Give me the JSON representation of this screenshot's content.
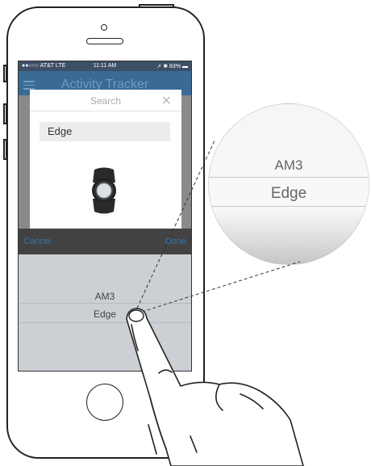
{
  "status_bar": {
    "carrier": "●●○○○ AT&T  LTE",
    "time": "11:11 AM",
    "battery": "➚ ✱ 83% ▬"
  },
  "nav": {
    "title": "Activity Tracker"
  },
  "dialog": {
    "title": "Search",
    "close": "✕",
    "search_value": "Edge"
  },
  "toolbar": {
    "cancel": "Cancel",
    "done": "Done"
  },
  "picker": {
    "options": [
      "AM3",
      "Edge"
    ],
    "selected": "Edge"
  },
  "magnifier": {
    "options": [
      "AM3",
      "Edge"
    ]
  },
  "colors": {
    "nav_bg": "#3b6a95",
    "accent": "#3b74ad",
    "toolbar_bg": "#424242",
    "picker_bg": "#ccd0d5"
  }
}
